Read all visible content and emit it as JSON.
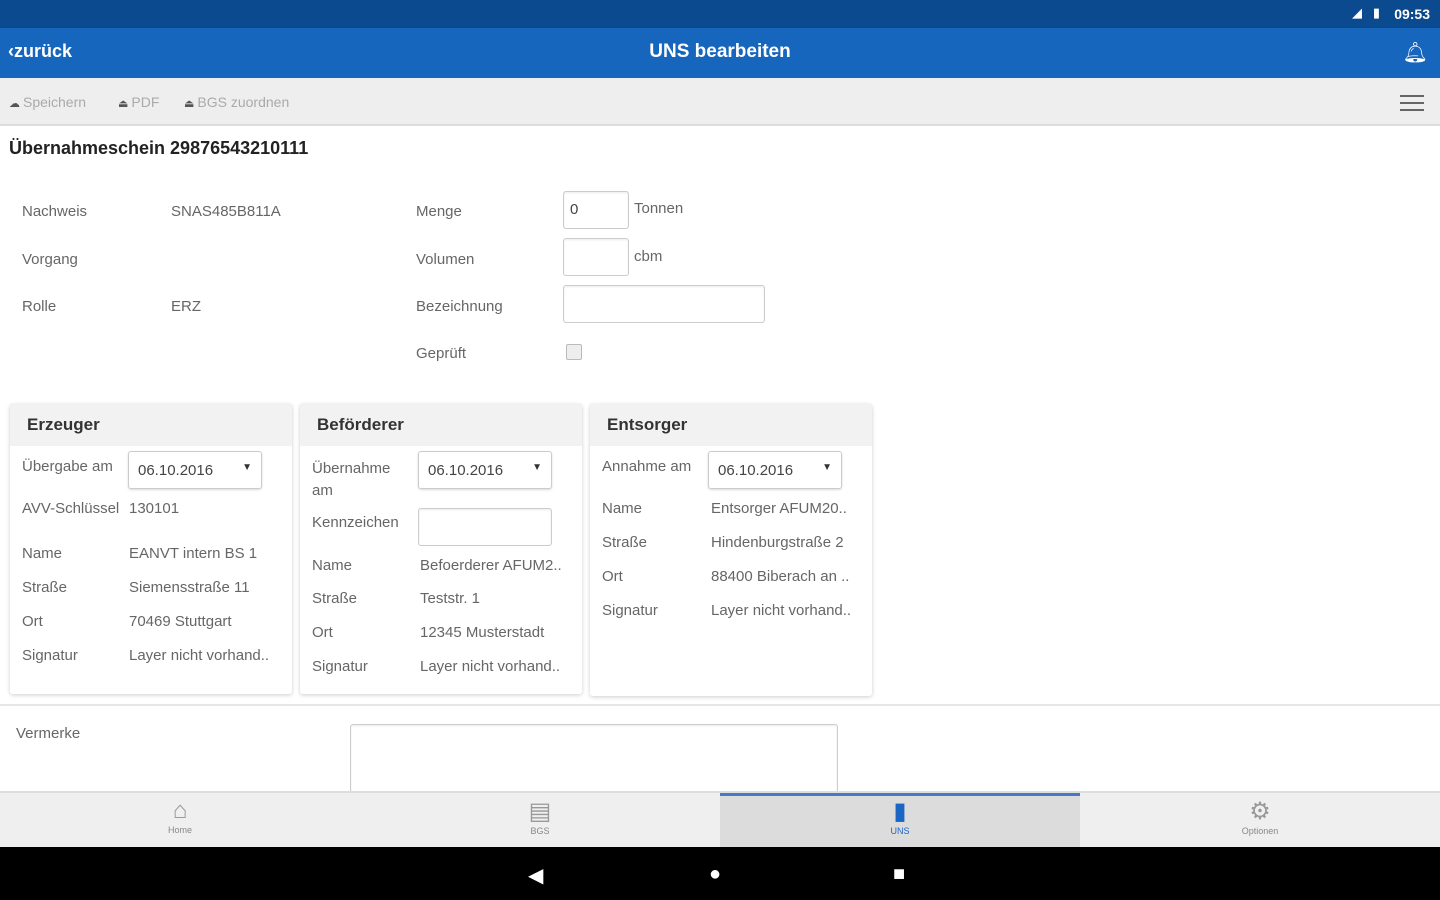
{
  "status_bar": {
    "time": "09:53"
  },
  "app_bar": {
    "back_label": "zurück",
    "title": "UNS bearbeiten"
  },
  "toolbar": {
    "save_label": "Speichern",
    "pdf_label": "PDF",
    "bgs_label": "BGS zuordnen"
  },
  "document": {
    "title": "Übernahmeschein 29876543210111"
  },
  "form": {
    "nachweis_label": "Nachweis",
    "nachweis_value": "SNAS485B811A",
    "vorgang_label": "Vorgang",
    "rolle_label": "Rolle",
    "rolle_value": "ERZ",
    "menge_label": "Menge",
    "menge_value": "0",
    "menge_unit": "Tonnen",
    "volumen_label": "Volumen",
    "volumen_value": "",
    "volumen_unit": "cbm",
    "bezeichnung_label": "Bezeichnung",
    "bezeichnung_value": "",
    "geprueft_label": "Geprüft",
    "geprueft_checked": false
  },
  "erzeuger": {
    "title": "Erzeuger",
    "date_label": "Übergabe am",
    "date": "06.10.2016",
    "avv_label": "AVV-Schlüssel",
    "avv": "130101",
    "name_label": "Name",
    "name": "EANVT intern BS 1",
    "strasse_label": "Straße",
    "strasse": "Siemensstraße 11",
    "ort_label": "Ort",
    "ort": "70469 Stuttgart",
    "signatur_label": "Signatur",
    "signatur": "Layer nicht vorhand.."
  },
  "befoerderer": {
    "title": "Beförderer",
    "date_label": "Übernahme am",
    "date": "06.10.2016",
    "kennzeichen_label": "Kennzeichen",
    "kennzeichen": "",
    "name_label": "Name",
    "name": "Befoerderer AFUM2..",
    "strasse_label": "Straße",
    "strasse": "Teststr. 1",
    "ort_label": "Ort",
    "ort": "12345 Musterstadt",
    "signatur_label": "Signatur",
    "signatur": "Layer nicht vorhand.."
  },
  "entsorger": {
    "title": "Entsorger",
    "date_label": "Annahme am",
    "date": "06.10.2016",
    "name_label": "Name",
    "name": "Entsorger AFUM20..",
    "strasse_label": "Straße",
    "strasse": "Hindenburgstraße 2",
    "ort_label": "Ort",
    "ort": "88400 Biberach an ..",
    "signatur_label": "Signatur",
    "signatur": "Layer nicht vorhand.."
  },
  "vermerke": {
    "label": "Vermerke",
    "value": ""
  },
  "bottom_nav": [
    {
      "label": "Home"
    },
    {
      "label": "BGS"
    },
    {
      "label": "UNS",
      "active": true
    },
    {
      "label": "Optionen"
    }
  ],
  "colors": {
    "status": "#0b4a8e",
    "appbar": "#1766bd",
    "active": "#1a66c4"
  }
}
